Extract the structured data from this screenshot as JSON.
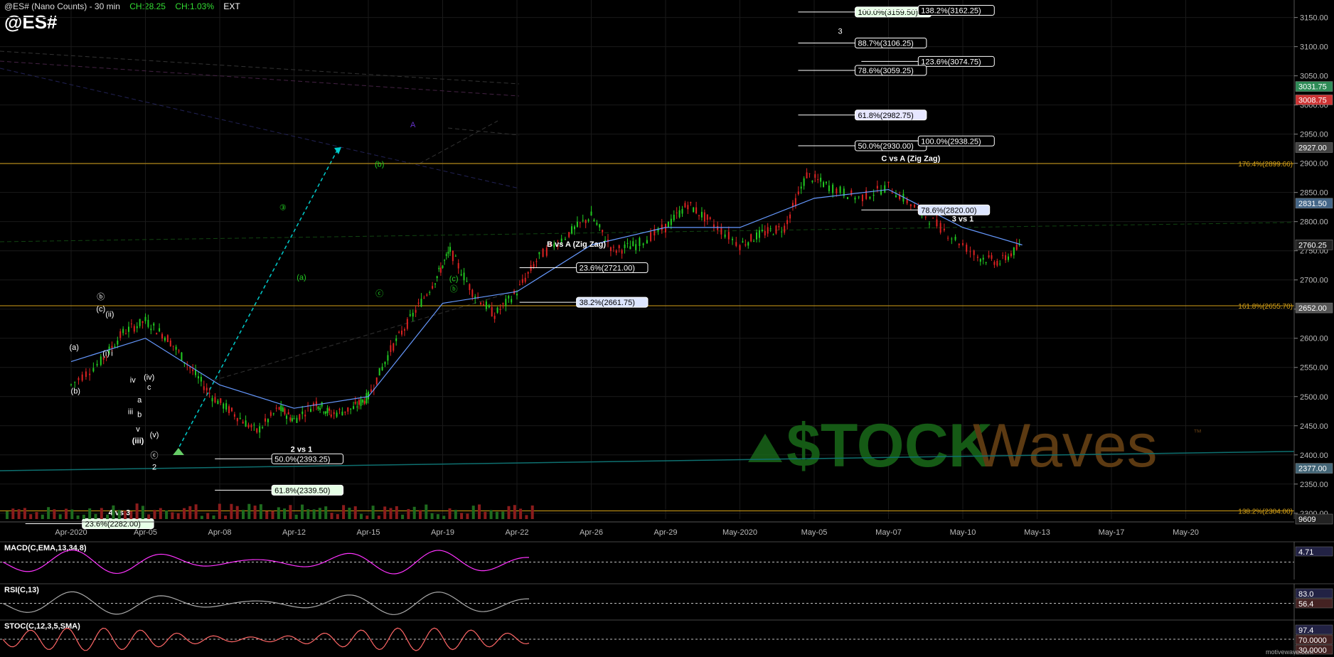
{
  "header": {
    "title": "@ES# (Nano Counts) - 30 min",
    "change": "CH:28.25",
    "change_pct": "CH:1.03%",
    "session": "EXT",
    "symbol": "@ES#"
  },
  "watermark": {
    "brand_left": "$TOCK",
    "brand_right": "Waves",
    "tm": "™"
  },
  "footer": {
    "site": "motivewave.com"
  },
  "colors": {
    "price_up": "#22cc22",
    "price_down": "#dd2222",
    "fib_box": "#ffffff",
    "fib_gold": "#d4a017",
    "cyan": "#00cccc",
    "purple": "#6633cc",
    "ma_blue": "#6699ff"
  },
  "chart_data": [
    {
      "type": "line",
      "name": "price",
      "x": [
        "Apr-2020",
        "Apr-05",
        "Apr-08",
        "Apr-12",
        "Apr-15",
        "Apr-19",
        "Apr-22",
        "Apr-26",
        "Apr-29",
        "May-2020",
        "May-05",
        "May-07",
        "May-10",
        "May-13",
        "May-17",
        "May-20"
      ],
      "x_ticks": [
        "Apr-2020",
        "Apr-05",
        "Apr-08",
        "Apr-12",
        "Apr-15",
        "Apr-19",
        "Apr-22",
        "Apr-26",
        "Apr-29",
        "May-2020",
        "May-05",
        "May-07",
        "May-10",
        "May-13",
        "May-17",
        "May-20"
      ],
      "y_ticks": [
        2300,
        2350,
        2400,
        2450,
        2500,
        2550,
        2600,
        2650,
        2700,
        2750,
        2800,
        2850,
        2900,
        2950,
        3000,
        3050,
        3100,
        3150
      ],
      "ylim": [
        2290,
        3180
      ],
      "price_path": [
        [
          0,
          2520
        ],
        [
          0.4,
          2560
        ],
        [
          0.7,
          2610
        ],
        [
          1.0,
          2630
        ],
        [
          1.3,
          2600
        ],
        [
          1.6,
          2550
        ],
        [
          1.9,
          2500
        ],
        [
          2.2,
          2470
        ],
        [
          2.5,
          2440
        ],
        [
          2.8,
          2480
        ],
        [
          3.0,
          2460
        ],
        [
          3.3,
          2490
        ],
        [
          3.5,
          2470
        ],
        [
          3.8,
          2480
        ],
        [
          4.0,
          2500
        ],
        [
          4.3,
          2580
        ],
        [
          4.6,
          2640
        ],
        [
          4.9,
          2700
        ],
        [
          5.1,
          2750
        ],
        [
          5.4,
          2680
        ],
        [
          5.7,
          2640
        ],
        [
          6.0,
          2680
        ],
        [
          6.3,
          2740
        ],
        [
          6.7,
          2780
        ],
        [
          7.0,
          2810
        ],
        [
          7.3,
          2750
        ],
        [
          7.6,
          2760
        ],
        [
          8.0,
          2790
        ],
        [
          8.3,
          2830
        ],
        [
          8.6,
          2800
        ],
        [
          9.0,
          2760
        ],
        [
          9.3,
          2780
        ],
        [
          9.6,
          2790
        ],
        [
          9.9,
          2880
        ],
        [
          10.2,
          2860
        ],
        [
          10.6,
          2840
        ],
        [
          11.0,
          2860
        ],
        [
          11.4,
          2820
        ],
        [
          11.8,
          2780
        ],
        [
          12.2,
          2740
        ],
        [
          12.5,
          2730
        ],
        [
          12.8,
          2760
        ]
      ],
      "ma_path": [
        [
          0,
          2560
        ],
        [
          1.0,
          2600
        ],
        [
          2.0,
          2520
        ],
        [
          3.0,
          2480
        ],
        [
          4.0,
          2500
        ],
        [
          5.0,
          2660
        ],
        [
          6.0,
          2680
        ],
        [
          7.0,
          2760
        ],
        [
          8.0,
          2790
        ],
        [
          9.0,
          2790
        ],
        [
          10.0,
          2840
        ],
        [
          11.0,
          2855
        ],
        [
          12.0,
          2790
        ],
        [
          12.8,
          2760
        ]
      ],
      "price_axis_tags": [
        {
          "value": 3031.75,
          "label": "3031.75",
          "color": "#2e8b57"
        },
        {
          "value": 3008.75,
          "label": "3008.75",
          "color": "#cc3333"
        },
        {
          "value": 2927.0,
          "label": "2927.00",
          "color": "#444"
        },
        {
          "value": 2831.5,
          "label": "2831.50",
          "color": "#446688"
        },
        {
          "value": 2760.25,
          "label": "2760.25",
          "color": "#222"
        },
        {
          "value": 2652.0,
          "label": "2652.00",
          "color": "#555"
        },
        {
          "value": 2377.0,
          "label": "2377.00",
          "color": "#446677"
        },
        {
          "value": 2290.0,
          "label": "9609",
          "color": "#222"
        }
      ],
      "gold_lines": [
        {
          "value": 2899.66,
          "label": "176.4%(2899.66)"
        },
        {
          "value": 2655.7,
          "label": "161.8%(2655.70)"
        },
        {
          "value": 2304.0,
          "label": "138.2%(2304.00)"
        }
      ],
      "fib_boxes": [
        {
          "label": "100.0%(3159.50)",
          "value": 3159.5,
          "x": 10.55,
          "fill": "#e6ffe6"
        },
        {
          "label": "138.2%(3162.25)",
          "value": 3162.25,
          "x": 11.4,
          "fill": "#000"
        },
        {
          "label": "88.7%(3106.25)",
          "value": 3106.25,
          "x": 10.55,
          "fill": "#000"
        },
        {
          "label": "123.6%(3074.75)",
          "value": 3074.75,
          "x": 11.4,
          "fill": "#000"
        },
        {
          "label": "78.6%(3059.25)",
          "value": 3059.25,
          "x": 10.55,
          "fill": "#000"
        },
        {
          "label": "61.8%(2982.75)",
          "value": 2982.75,
          "x": 10.55,
          "fill": "#e6e6ff"
        },
        {
          "label": "50.0%(2930.00)",
          "value": 2930.0,
          "x": 10.55,
          "fill": "#000"
        },
        {
          "label": "100.0%(2938.25)",
          "value": 2938.25,
          "x": 11.4,
          "fill": "#000"
        },
        {
          "label": "78.6%(2820.00)",
          "value": 2820.0,
          "x": 11.4,
          "fill": "#dde6ff"
        },
        {
          "label": "23.6%(2721.00)",
          "value": 2721.0,
          "x": 6.8,
          "fill": "#000"
        },
        {
          "label": "38.2%(2661.75)",
          "value": 2661.75,
          "x": 6.8,
          "fill": "#dde6ff"
        },
        {
          "label": "50.0%(2393.25)",
          "value": 2393.25,
          "x": 2.7,
          "fill": "#000"
        },
        {
          "label": "61.8%(2339.50)",
          "value": 2339.5,
          "x": 2.7,
          "fill": "#e6ffe6"
        },
        {
          "label": "23.6%(2282.00)",
          "value": 2282.0,
          "x": 0.15,
          "fill": "#e6ffe6"
        }
      ],
      "annotations": [
        {
          "text": "C vs A (Zig Zag)",
          "x": 11.3,
          "value": 2904,
          "color": "#fff"
        },
        {
          "text": "3 vs 1",
          "x": 12.0,
          "value": 2800,
          "color": "#fff"
        },
        {
          "text": "B vs A (Zig Zag)",
          "x": 6.8,
          "value": 2757,
          "color": "#fff"
        },
        {
          "text": "2 vs 1",
          "x": 3.1,
          "value": 2405,
          "color": "#fff"
        },
        {
          "text": "4 vs 3",
          "x": 0.65,
          "value": 2297,
          "color": "#fff"
        },
        {
          "text": "3",
          "x": 10.35,
          "value": 3122,
          "color": "#fff"
        },
        {
          "text": "(b)",
          "x": 4.15,
          "value": 2894,
          "color": "#22cc22"
        },
        {
          "text": "ⓒ",
          "x": 4.15,
          "value": 2672,
          "color": "#22cc22"
        },
        {
          "text": "(c)",
          "x": 5.15,
          "value": 2698,
          "color": "#22cc22"
        },
        {
          "text": "ⓑ",
          "x": 5.15,
          "value": 2680,
          "color": "#22cc22"
        },
        {
          "text": "③",
          "x": 2.85,
          "value": 2820,
          "color": "#22cc22"
        },
        {
          "text": "(a)",
          "x": 3.1,
          "value": 2700,
          "color": "#22cc22"
        },
        {
          "text": "A",
          "x": 4.6,
          "value": 2962,
          "color": "#6633cc"
        },
        {
          "text": "ⓑ",
          "x": 0.4,
          "value": 2667,
          "color": "#fff"
        },
        {
          "text": "(c)",
          "x": 0.4,
          "value": 2646,
          "color": "#fff"
        },
        {
          "text": "(ii)",
          "x": 0.52,
          "value": 2637,
          "color": "#fff"
        },
        {
          "text": "(a)",
          "x": 0.04,
          "value": 2580,
          "color": "#fff"
        },
        {
          "text": "(b)",
          "x": 0.06,
          "value": 2505,
          "color": "#fff"
        },
        {
          "text": "(i)",
          "x": 0.47,
          "value": 2570,
          "color": "#fff"
        },
        {
          "text": "i",
          "x": 0.55,
          "value": 2570,
          "color": "#fff"
        },
        {
          "text": "iv",
          "x": 0.83,
          "value": 2524,
          "color": "#fff"
        },
        {
          "text": "(iv)",
          "x": 1.05,
          "value": 2529,
          "color": "#fff"
        },
        {
          "text": "c",
          "x": 1.05,
          "value": 2512,
          "color": "#fff"
        },
        {
          "text": "a",
          "x": 0.92,
          "value": 2490,
          "color": "#fff"
        },
        {
          "text": "b",
          "x": 0.92,
          "value": 2465,
          "color": "#fff"
        },
        {
          "text": "iii",
          "x": 0.8,
          "value": 2470,
          "color": "#fff"
        },
        {
          "text": "v",
          "x": 0.9,
          "value": 2440,
          "color": "#fff"
        },
        {
          "text": "(iii)",
          "x": 0.9,
          "value": 2420,
          "color": "#fff"
        },
        {
          "text": "(v)",
          "x": 1.12,
          "value": 2430,
          "color": "#fff"
        },
        {
          "text": "ⓒ",
          "x": 1.12,
          "value": 2395,
          "color": "#fff"
        },
        {
          "text": "2",
          "x": 1.12,
          "value": 2375,
          "color": "#fff"
        }
      ]
    },
    {
      "type": "line",
      "name": "MACD",
      "title": "MACD(C,EMA,13,34,8)",
      "value_tag": "4.71"
    },
    {
      "type": "line",
      "name": "RSI",
      "title": "RSI(C,13)",
      "value_tags": [
        "83.0",
        "56.4"
      ]
    },
    {
      "type": "line",
      "name": "STOC",
      "title": "STOC(C,12,3,5,SMA)",
      "value_tags": [
        "97.4",
        "70.0000",
        "30.0000"
      ]
    }
  ]
}
